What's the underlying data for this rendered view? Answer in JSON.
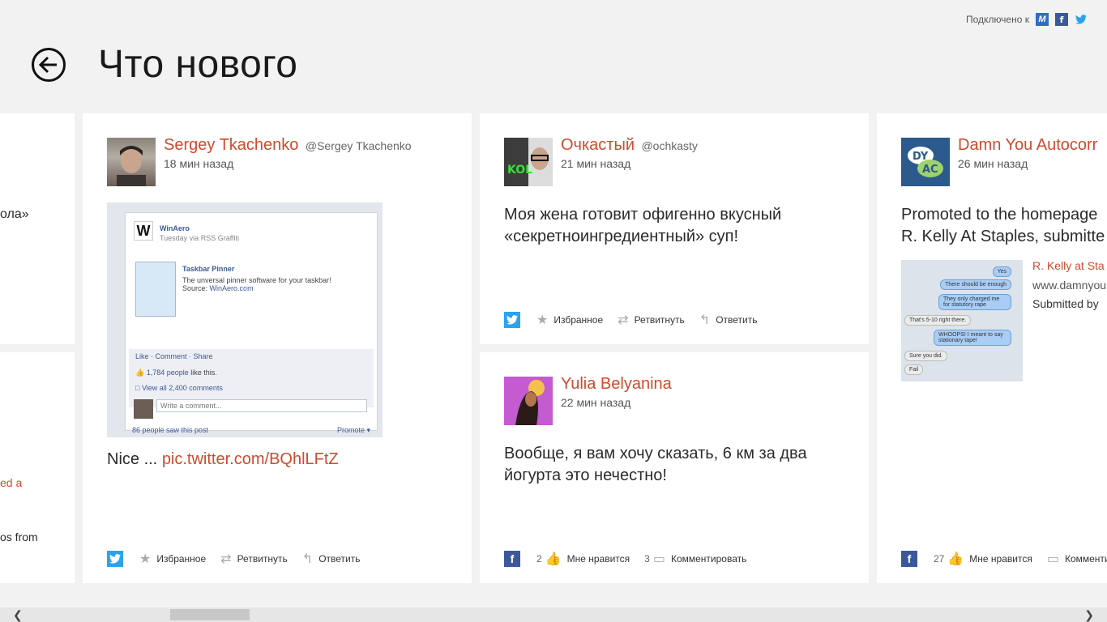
{
  "header": {
    "title": "Что нового",
    "connected_label": "Подключено к",
    "services": [
      "M",
      "f",
      "t"
    ]
  },
  "left_fragments": [
    "ола»",
    "ed a",
    "os from"
  ],
  "posts": [
    {
      "name": "Sergey Tkachenko",
      "handle": "@Sergey Tkachenko",
      "time": "18 мин назад",
      "text": "Nice ...",
      "link": "pic.twitter.com/BQhlLFtZ",
      "network": "twitter",
      "actions": [
        "Избранное",
        "Ретвитнуть",
        "Ответить"
      ],
      "embed": {
        "page": "WinAero",
        "sub": "Tuesday via RSS Graffiti",
        "post_title": "Taskbar Pinner",
        "post_desc": "The unversal pinner software for your taskbar!",
        "post_source_label": "Source:",
        "post_source": "WinAero.com",
        "fb_actions": "Like · Comment · Share",
        "likes": "1,784 people",
        "likes_suffix": "like this.",
        "comments": "View all 2,400 comments",
        "write": "Write a comment...",
        "seen": "86 people saw this post",
        "promote": "Promote"
      }
    },
    {
      "name": "Очкастый",
      "handle": "@ochkasty",
      "time": "21 мин назад",
      "text": "Моя жена готовит офигенно вкусный «секретноингредиентный» суп!",
      "network": "twitter",
      "actions": [
        "Избранное",
        "Ретвитнуть",
        "Ответить"
      ]
    },
    {
      "name": "Yulia Belyanina",
      "time": "22 мин назад",
      "text": "Вообще, я вам хочу сказать, 6 км за два йогурта это нечестно!",
      "network": "facebook",
      "likes_count": "2",
      "like_label": "Мне нравится",
      "comments_count": "3",
      "comment_label": "Комментировать"
    },
    {
      "name": "Damn You Autocorr",
      "time": "26 мин назад",
      "text_line1": "Promoted to the homepage",
      "text_line2": "R. Kelly At Staples, submitte",
      "link_title": "R. Kelly at Sta",
      "link_url": "www.damnyou",
      "link_sub": "Submitted by",
      "network": "facebook",
      "likes_count": "27",
      "like_label": "Мне нравится",
      "comment_label": "Комментир",
      "avatar_text_top": "DY",
      "avatar_text_bottom": "AC",
      "phone_bubbles": [
        "Yes",
        "There should be enough",
        "They only charged me for statutory rape",
        "That's 5-10 right there.",
        "WHOOPS! I meant to say stationary tape!",
        "Sure you did.",
        "Fail"
      ]
    }
  ],
  "colors": {
    "accent": "#d04a2e",
    "twitter": "#2aa3ef",
    "facebook": "#3b5998"
  }
}
